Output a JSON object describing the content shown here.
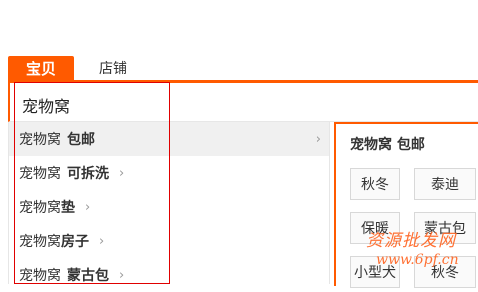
{
  "tabs": [
    {
      "label": "宝贝",
      "active": true
    },
    {
      "label": "店铺",
      "active": false
    }
  ],
  "search": {
    "value": "宠物窝"
  },
  "suggestions": [
    {
      "query": "宠物窝",
      "bold": "包邮",
      "active": true
    },
    {
      "query": "宠物窝",
      "bold": "可拆洗",
      "active": false
    },
    {
      "query": "宠物窝",
      "bold": "垫",
      "active": false
    },
    {
      "query": "宠物窝",
      "bold": "房子",
      "active": false
    },
    {
      "query": "宠物窝",
      "bold": "蒙古包",
      "active": false
    }
  ],
  "detail": {
    "title": "宠物窝 包邮",
    "tags": [
      "秋冬",
      "泰迪",
      "保暖",
      "蒙古包",
      "小型犬",
      "秋冬"
    ]
  },
  "watermark": {
    "text": "资源批发网",
    "url": "www.6pf.cn"
  },
  "colors": {
    "accent": "#ff5a00",
    "highlight": "#e00000",
    "watermark": "#ff6a2a"
  }
}
